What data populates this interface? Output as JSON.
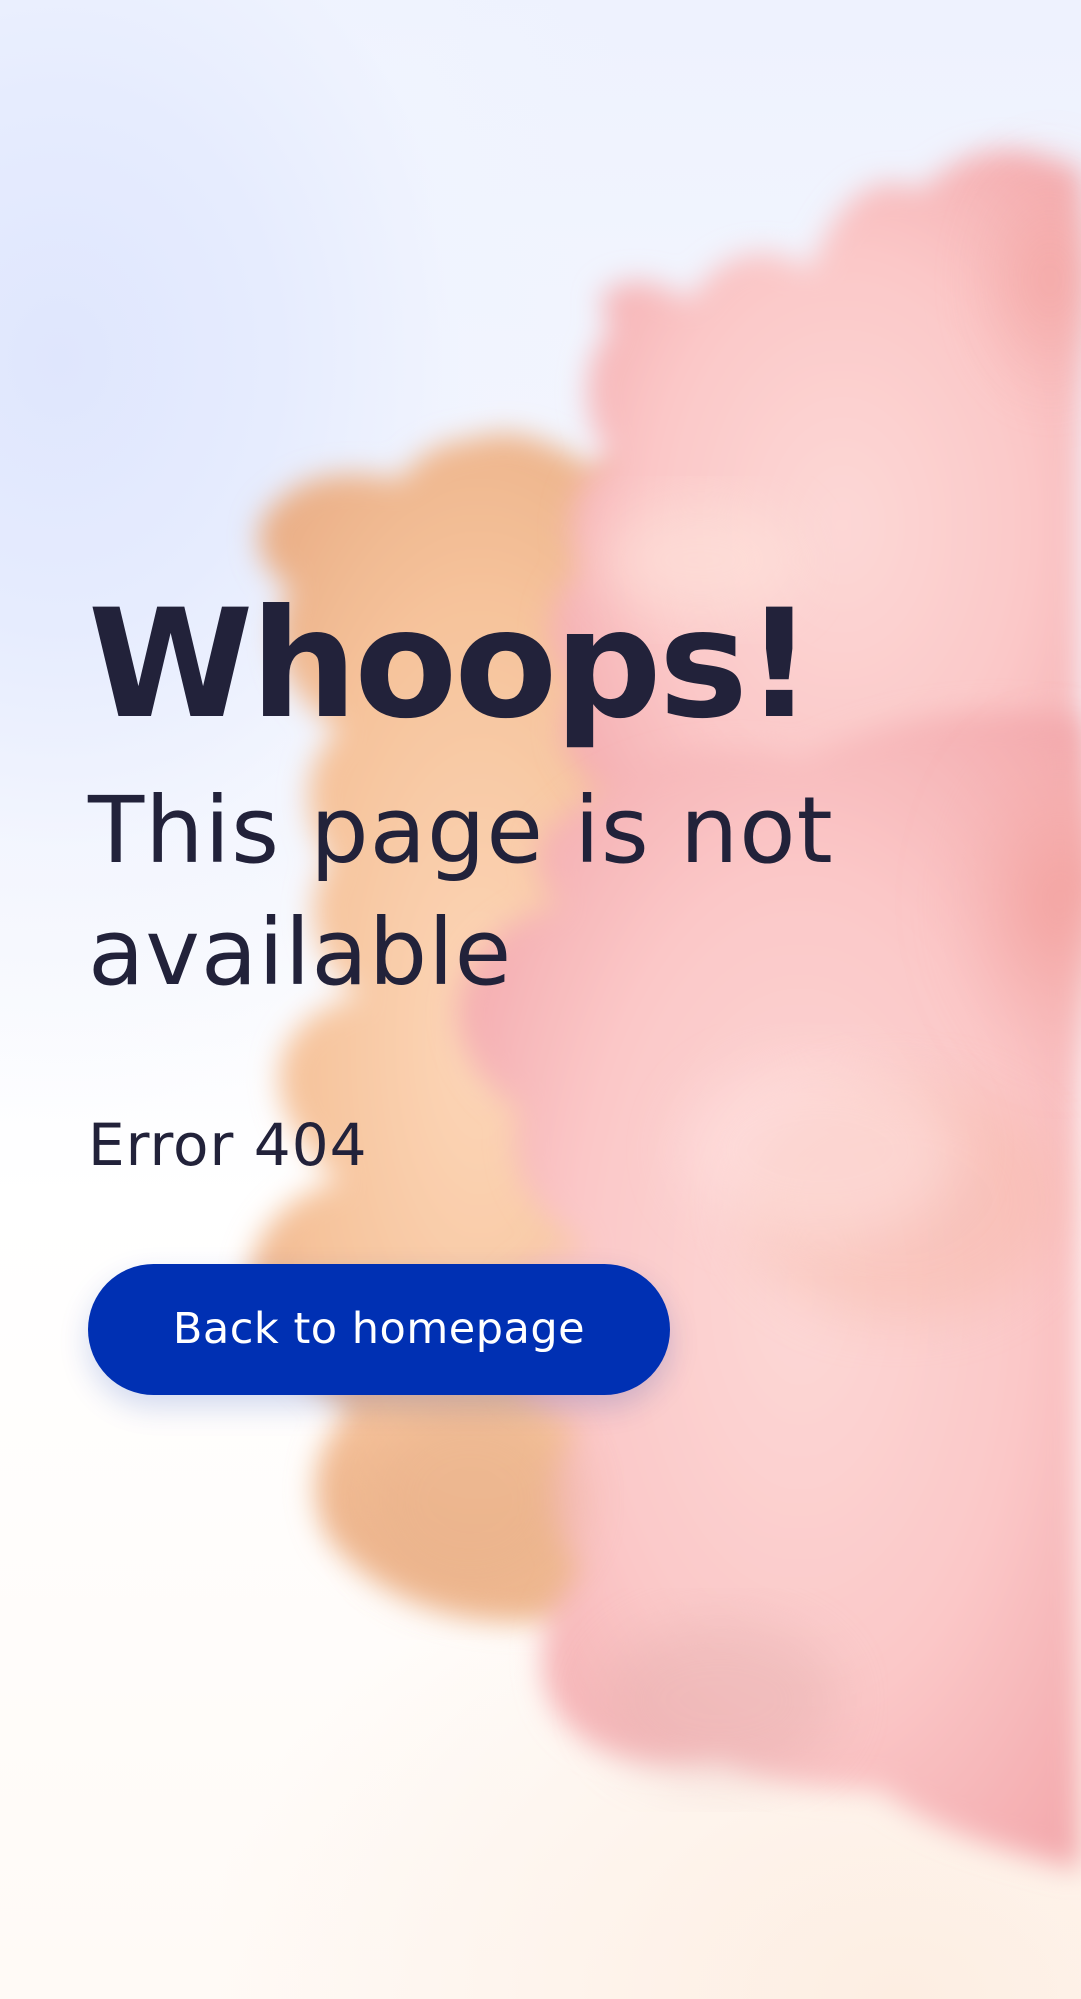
{
  "page": {
    "background_colors": [
      "#e2e9fd",
      "#ffffff",
      "#fdeee2"
    ],
    "art": {
      "icon": "abstract-3d-blob-illustration",
      "colors": [
        "#f9c9a6",
        "#fbcdd0",
        "#f6a9ad"
      ]
    }
  },
  "error": {
    "headline": "Whoops!",
    "message": "This page is not available",
    "code": "Error 404"
  },
  "actions": {
    "back_label": "Back to homepage",
    "button_color": "#0030b3",
    "text_color": "#22223a"
  }
}
